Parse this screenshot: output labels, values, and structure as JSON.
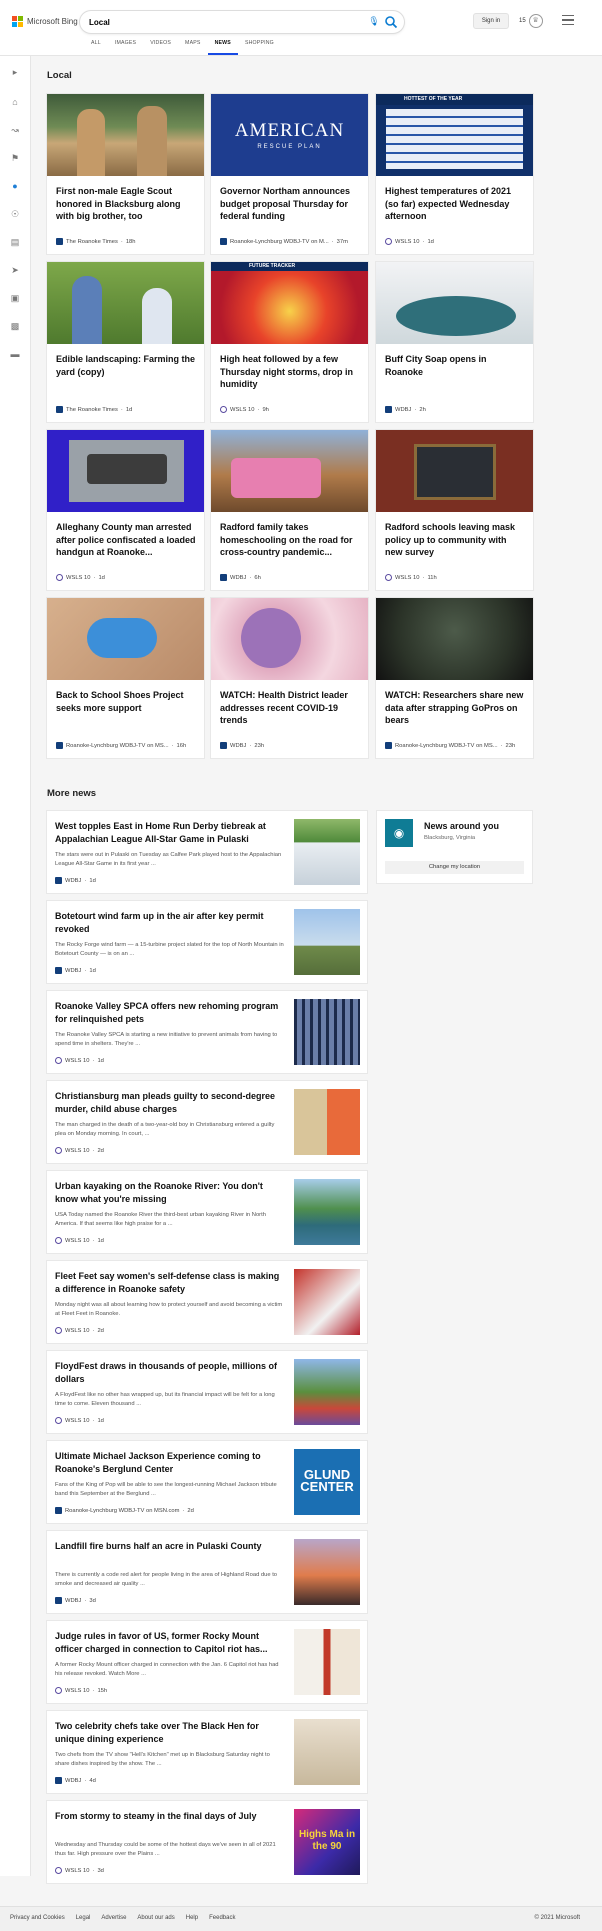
{
  "header": {
    "brand": "Microsoft Bing",
    "search_value": "Local",
    "signin": "Sign in",
    "rewards": "15",
    "tabs": [
      "ALL",
      "IMAGES",
      "VIDEOS",
      "MAPS",
      "NEWS",
      "SHOPPING"
    ],
    "active_tab": "NEWS"
  },
  "local": {
    "title": "Local",
    "cards": [
      {
        "title": "First non-male Eagle Scout honored in Blacksburg along with big brother, too",
        "source": "The Roanoke Times",
        "age": "18h"
      },
      {
        "title": "Governor Northam announces budget proposal Thursday for federal funding",
        "source": "Roanoke-Lynchburg WDBJ-TV on M...",
        "age": "37m",
        "img_text": "AMERICAN",
        "img_sub": "RESCUE PLAN"
      },
      {
        "title": "Highest temperatures of 2021 (so far) expected Wednesday afternoon",
        "source": "WSLS 10",
        "age": "1d",
        "img_text": "HOTTEST OF THE YEAR"
      },
      {
        "title": "Edible landscaping: Farming the yard (copy)",
        "source": "The Roanoke Times",
        "age": "1d"
      },
      {
        "title": "High heat followed by a few Thursday night storms, drop in humidity",
        "source": "WSLS 10",
        "age": "9h",
        "img_text": "FUTURE TRACKER"
      },
      {
        "title": "Buff City Soap opens in Roanoke",
        "source": "WDBJ",
        "age": "2h"
      },
      {
        "title": "Alleghany County man arrested after police confiscated a loaded handgun at Roanoke...",
        "source": "WSLS 10",
        "age": "1d"
      },
      {
        "title": "Radford family takes homeschooling on the road for cross-country pandemic...",
        "source": "WDBJ",
        "age": "6h"
      },
      {
        "title": "Radford schools leaving mask policy up to community with new survey",
        "source": "WSLS 10",
        "age": "11h"
      },
      {
        "title": "Back to School Shoes Project seeks more support",
        "source": "Roanoke-Lynchburg WDBJ-TV on MS...",
        "age": "16h"
      },
      {
        "title": "WATCH: Health District leader addresses recent COVID-19 trends",
        "source": "WDBJ",
        "age": "23h"
      },
      {
        "title": "WATCH: Researchers share new data after strapping GoPros on bears",
        "source": "Roanoke-Lynchburg WDBJ-TV on MS...",
        "age": "23h"
      }
    ]
  },
  "more": {
    "title": "More news",
    "items": [
      {
        "title": "West topples East in Home Run Derby tiebreak at Appalachian League All-Star Game in Pulaski",
        "snippet": "The stars were out in Pulaski on Tuesday as Calfee Park played host to the Appalachian League All-Star Game in its first year ...",
        "source": "WDBJ",
        "age": "1d"
      },
      {
        "title": "Botetourt wind farm up in the air after key permit revoked",
        "snippet": "The Rocky Forge wind farm — a 15-turbine project slated for the top of North Mountain in Botetourt County — is on an ...",
        "source": "WDBJ",
        "age": "1d"
      },
      {
        "title": "Roanoke Valley SPCA offers new rehoming program for relinquished pets",
        "snippet": "The Roanoke Valley SPCA is starting a new initiative to prevent animals from having to spend time in shelters. They're ...",
        "source": "WSLS 10",
        "age": "1d"
      },
      {
        "title": "Christiansburg man pleads guilty to second-degree murder, child abuse charges",
        "snippet": "The man charged in the death of a two-year-old boy in Christiansburg entered a guilty plea on Monday morning. In court, ...",
        "source": "WSLS 10",
        "age": "2d"
      },
      {
        "title": "Urban kayaking on the Roanoke River: You don't know what you're missing",
        "snippet": "USA Today named the Roanoke River the third-best urban kayaking River in North America. If that seems like high praise for a ...",
        "source": "WSLS 10",
        "age": "1d"
      },
      {
        "title": "Fleet Feet say women's self-defense class is making a difference in Roanoke safety",
        "snippet": "Monday night was all about learning how to protect yourself and avoid becoming a victim at Fleet Feet in Roanoke.",
        "source": "WSLS 10",
        "age": "2d"
      },
      {
        "title": "FloydFest draws in thousands of people, millions of dollars",
        "snippet": "A FloydFest like no other has wrapped up, but its financial impact will be felt for a long time to come. Eleven thousand ...",
        "source": "WSLS 10",
        "age": "1d"
      },
      {
        "title": "Ultimate Michael Jackson Experience coming to Roanoke's Berglund Center",
        "snippet": "Fans of the King of Pop will be able to see the longest-running Michael Jackson tribute band this September at the Berglund ...",
        "source": "Roanoke-Lynchburg WDBJ-TV on MSN.com",
        "age": "2d",
        "img_text": "GLUND CENTER"
      },
      {
        "title": "Landfill fire burns half an acre in Pulaski County",
        "snippet": "There is currently a code red alert for people living in the area of Highland Road due to smoke and decreased air quality ...",
        "source": "WDBJ",
        "age": "3d"
      },
      {
        "title": "Judge rules in favor of US, former Rocky Mount officer charged in connection to Capitol riot has...",
        "snippet": "A former Rocky Mount officer charged in connection with the Jan. 6 Capitol riot has had his release revoked. Watch More ...",
        "source": "WSLS 10",
        "age": "15h"
      },
      {
        "title": "Two celebrity chefs take over The Black Hen for unique dining experience",
        "snippet": "Two chefs from the TV show \"Hell's Kitchen\" met up in Blacksburg Saturday night to share dishes inspired by the show. The ...",
        "source": "WDBJ",
        "age": "4d"
      },
      {
        "title": "From stormy to steamy in the final days of July",
        "snippet": "Wednesday and Thursday could be some of the hottest days we've seen in all of 2021 thus far. High pressure over the Plains ...",
        "source": "WSLS 10",
        "age": "3d",
        "img_text": "Highs Ma in the 90"
      }
    ]
  },
  "around": {
    "title": "News around you",
    "location": "Blacksburg, Virginia",
    "button": "Change my location"
  },
  "footer": {
    "links": [
      "Privacy and Cookies",
      "Legal",
      "Advertise",
      "About our ads",
      "Help",
      "Feedback"
    ],
    "copyright": "© 2021 Microsoft"
  }
}
